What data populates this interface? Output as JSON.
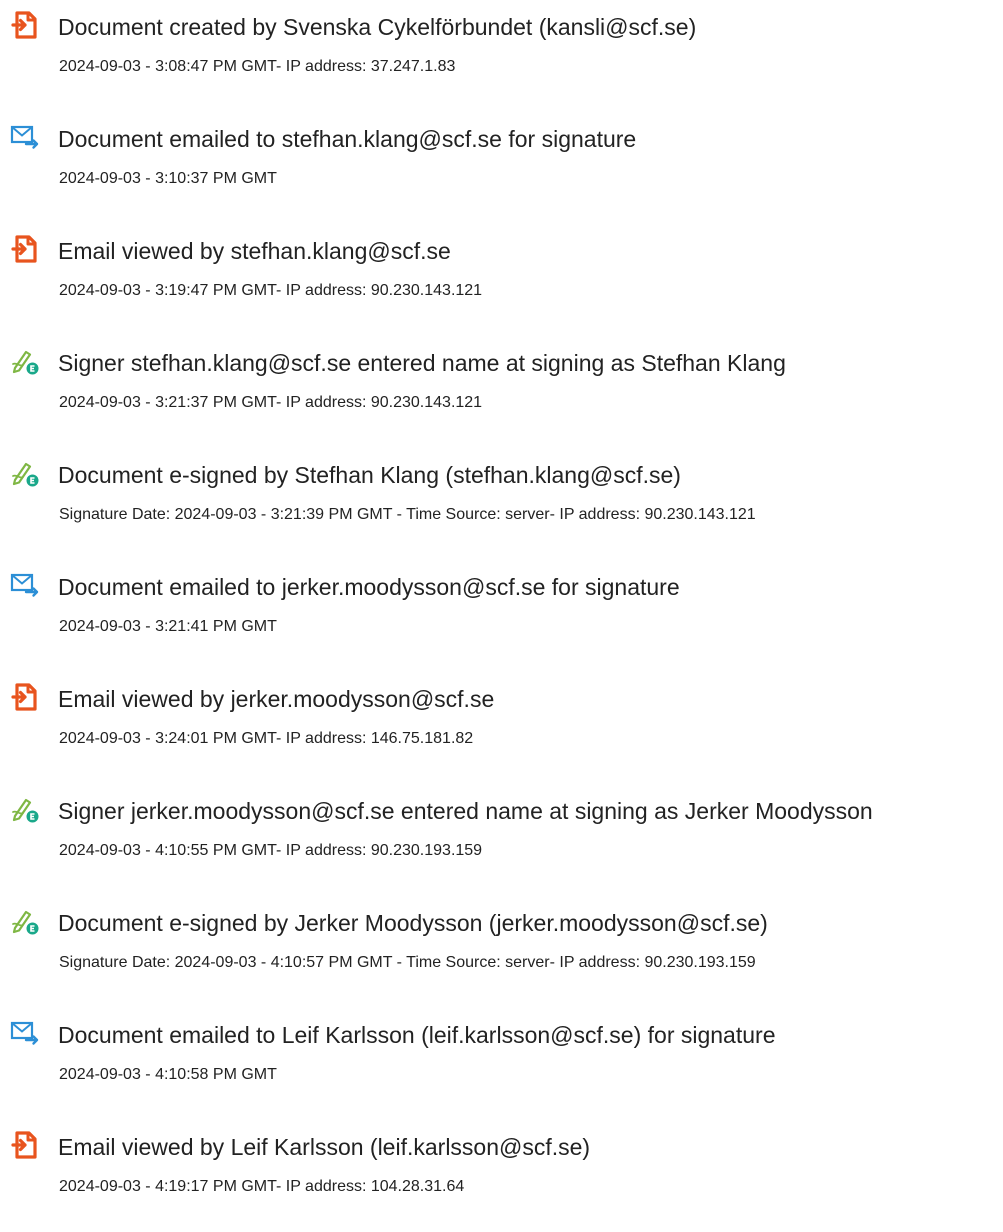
{
  "colors": {
    "pdf_icon": "#e8541e",
    "email_icon": "#2c8fd6",
    "sign_pen": "#7fb744",
    "sign_badge": "#1aa88a"
  },
  "entries": [
    {
      "icon": "pdf-document-icon",
      "title": "Document created by Svenska Cykelförbundet (kansli@scf.se)",
      "detail": "2024-09-03 - 3:08:47 PM GMT- IP address: 37.247.1.83"
    },
    {
      "icon": "email-send-icon",
      "title": "Document emailed to stefhan.klang@scf.se for signature",
      "detail": "2024-09-03 - 3:10:37 PM GMT"
    },
    {
      "icon": "pdf-document-icon",
      "title": "Email viewed by stefhan.klang@scf.se",
      "detail": "2024-09-03 - 3:19:47 PM GMT- IP address: 90.230.143.121"
    },
    {
      "icon": "signature-pen-icon",
      "title": "Signer stefhan.klang@scf.se entered name at signing as Stefhan Klang",
      "detail": "2024-09-03 - 3:21:37 PM GMT- IP address: 90.230.143.121"
    },
    {
      "icon": "signature-pen-icon",
      "title": "Document e-signed by Stefhan Klang (stefhan.klang@scf.se)",
      "detail": "Signature Date: 2024-09-03 - 3:21:39 PM GMT - Time Source: server- IP address: 90.230.143.121"
    },
    {
      "icon": "email-send-icon",
      "title": "Document emailed to jerker.moodysson@scf.se for signature",
      "detail": "2024-09-03 - 3:21:41 PM GMT"
    },
    {
      "icon": "pdf-document-icon",
      "title": "Email viewed by jerker.moodysson@scf.se",
      "detail": "2024-09-03 - 3:24:01 PM GMT- IP address: 146.75.181.82"
    },
    {
      "icon": "signature-pen-icon",
      "title": "Signer jerker.moodysson@scf.se entered name at signing as Jerker Moodysson",
      "detail": "2024-09-03 - 4:10:55 PM GMT- IP address: 90.230.193.159"
    },
    {
      "icon": "signature-pen-icon",
      "title": "Document e-signed by Jerker Moodysson (jerker.moodysson@scf.se)",
      "detail": "Signature Date: 2024-09-03 - 4:10:57 PM GMT - Time Source: server- IP address: 90.230.193.159"
    },
    {
      "icon": "email-send-icon",
      "title": "Document emailed to Leif Karlsson (leif.karlsson@scf.se) for signature",
      "detail": "2024-09-03 - 4:10:58 PM GMT"
    },
    {
      "icon": "pdf-document-icon",
      "title": "Email viewed by Leif Karlsson (leif.karlsson@scf.se)",
      "detail": "2024-09-03 - 4:19:17 PM GMT- IP address: 104.28.31.64"
    }
  ]
}
